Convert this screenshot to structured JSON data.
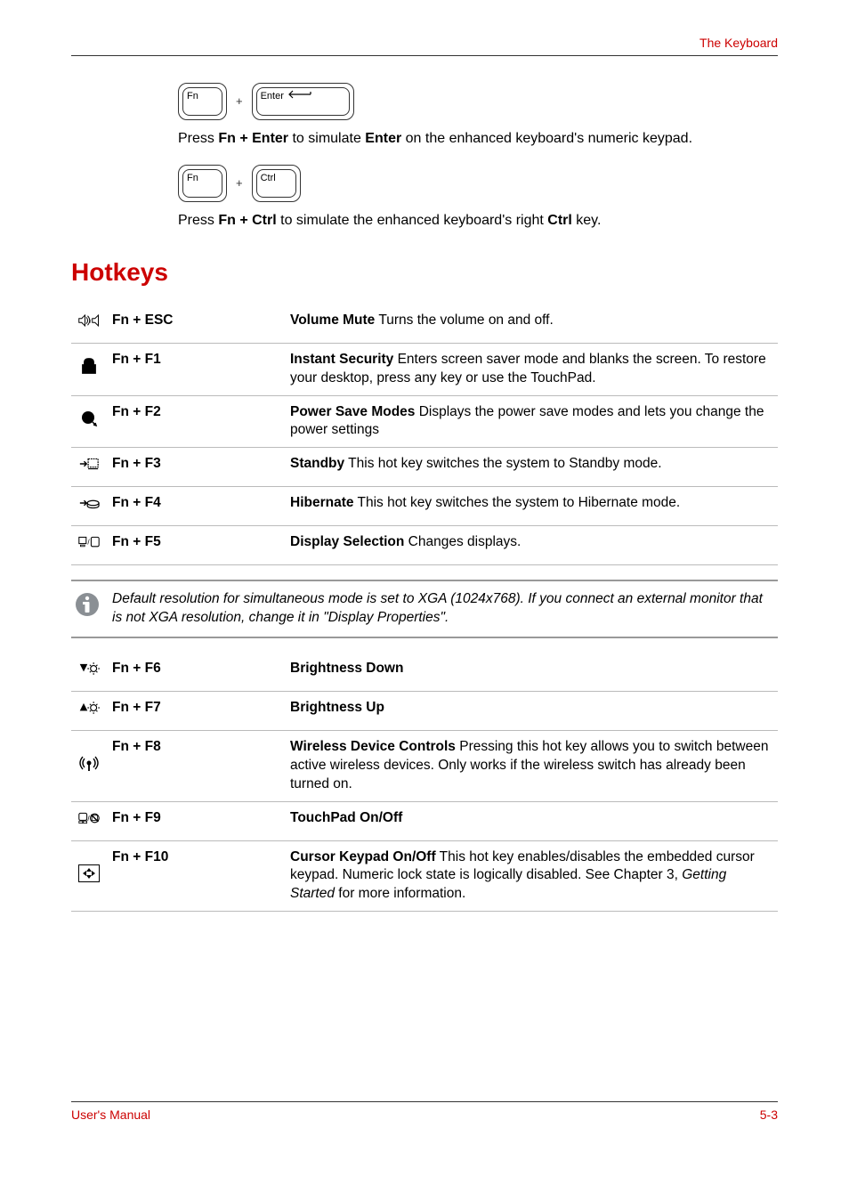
{
  "header": {
    "title": "The Keyboard"
  },
  "intro": {
    "fn_label": "Fn",
    "enter_label": "Enter",
    "ctrl_label": "Ctrl",
    "plus": "+",
    "para1_pre": "Press ",
    "para1_bold1": "Fn + Enter",
    "para1_mid": " to simulate ",
    "para1_bold2": "Enter",
    "para1_post": " on the enhanced keyboard's numeric keypad.",
    "para2_pre": "Press ",
    "para2_bold1": "Fn + Ctrl",
    "para2_mid": " to simulate the enhanced keyboard's right ",
    "para2_bold2": "Ctrl",
    "para2_post": " key."
  },
  "section_title": "Hotkeys",
  "hotkeys1": [
    {
      "combo": "Fn + ESC",
      "title": "Volume Mute",
      "desc": "   Turns the volume on and off."
    },
    {
      "combo": "Fn + F1",
      "title": "Instant Security",
      "desc": "   Enters screen saver mode and blanks the screen. To restore your desktop, press any key or use the TouchPad."
    },
    {
      "combo": "Fn + F2",
      "title": "Power Save Modes",
      "desc": "   Displays the power save modes and lets you change the power settings"
    },
    {
      "combo": "Fn + F3",
      "title": "Standby",
      "desc": "   This hot key switches the system to Standby mode."
    },
    {
      "combo": "Fn + F4",
      "title": "Hibernate",
      "desc": "   This hot key switches the system to Hibernate mode."
    },
    {
      "combo": "Fn + F5",
      "title": "Display Selection",
      "desc": "   Changes displays."
    }
  ],
  "note": {
    "text": "Default resolution for simultaneous mode is set to XGA (1024x768). If you connect an external monitor that is not XGA resolution, change it in \"Display Properties\"."
  },
  "hotkeys2": [
    {
      "combo": "Fn + F6",
      "title": "Brightness Down",
      "desc": ""
    },
    {
      "combo": "Fn + F7",
      "title": "Brightness Up",
      "desc": ""
    },
    {
      "combo": "Fn + F8",
      "title": "Wireless Device Controls",
      "desc": "   Pressing this hot key allows you to switch between active wireless devices. Only works if the wireless switch has already been turned on."
    },
    {
      "combo": "Fn + F9",
      "title": "TouchPad On/Off",
      "desc": ""
    },
    {
      "combo": "Fn + F10",
      "title": "Cursor Keypad On/Off",
      "desc_pre": "   This hot key enables/disables the embedded cursor keypad. Numeric lock state is logically disabled. See Chapter 3, ",
      "desc_italic": "Getting Started",
      "desc_post": " for more information."
    }
  ],
  "footer": {
    "left": "User's Manual",
    "right": "5-3"
  }
}
